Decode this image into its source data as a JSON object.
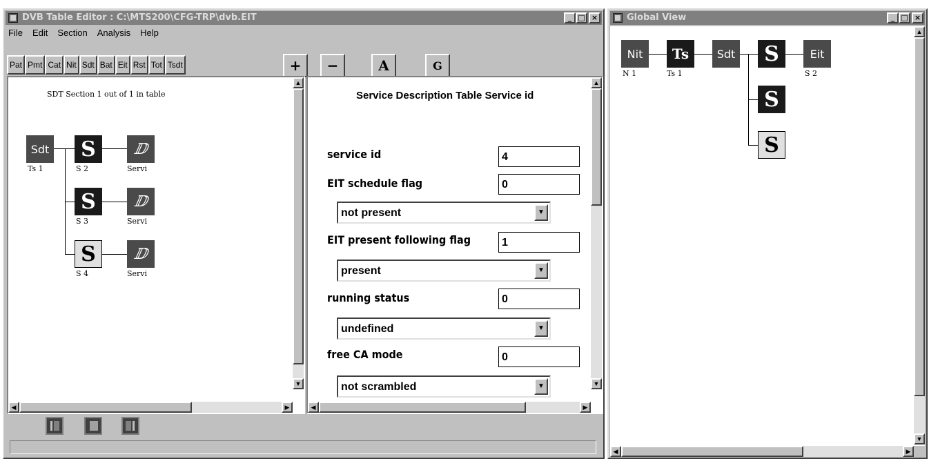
{
  "main_window": {
    "title": "DVB Table Editor : C:\\MTS200\\CFG-TRP\\dvb.EIT",
    "controls": {
      "minimize": "_",
      "maximize": "□",
      "close": "×"
    },
    "menu": [
      "File",
      "Edit",
      "Section",
      "Analysis",
      "Help"
    ],
    "table_buttons": [
      "Pat",
      "Pmt",
      "Cat",
      "Nit",
      "Sdt",
      "Bat",
      "Eit",
      "Rst",
      "Tot",
      "Tsdt"
    ],
    "tool_buttons": {
      "add": "+",
      "remove": "−",
      "a": "A",
      "g": "G"
    },
    "tree_panel": {
      "header": "SDT Section 1 out of 1 in table",
      "root": {
        "label": "Sdt",
        "sublabel": "Ts 1"
      },
      "services": [
        {
          "label": "S",
          "sublabel": "S 2",
          "child_sublabel": "Servi"
        },
        {
          "label": "S",
          "sublabel": "S 3",
          "child_sublabel": "Servi"
        },
        {
          "label": "S",
          "sublabel": "S 4",
          "child_sublabel": "Servi"
        }
      ]
    },
    "detail_panel": {
      "header": "Service Description Table Service id",
      "fields": {
        "service_id": {
          "label": "service id",
          "value": "4"
        },
        "eit_schedule": {
          "label": "EIT schedule flag",
          "value": "0",
          "select": "not present"
        },
        "eit_present": {
          "label": "EIT present following flag",
          "value": "1",
          "select": "present"
        },
        "running_status": {
          "label": "running status",
          "value": "0",
          "select": "undefined"
        },
        "free_ca": {
          "label": "free CA mode",
          "value": "0",
          "select": "not scrambled"
        }
      }
    }
  },
  "global_window": {
    "title": "Global View",
    "controls": {
      "minimize": "_",
      "maximize": "□",
      "close": "×"
    },
    "nodes": {
      "nit": {
        "label": "Nit",
        "sublabel": "N 1"
      },
      "ts": {
        "label": "Ts",
        "sublabel": "Ts 1"
      },
      "sdt": {
        "label": "Sdt"
      },
      "s1": {
        "label": "S"
      },
      "eit": {
        "label": "Eit",
        "sublabel": "S 2"
      },
      "s2": {
        "label": "S"
      },
      "s3": {
        "label": "S"
      }
    }
  }
}
